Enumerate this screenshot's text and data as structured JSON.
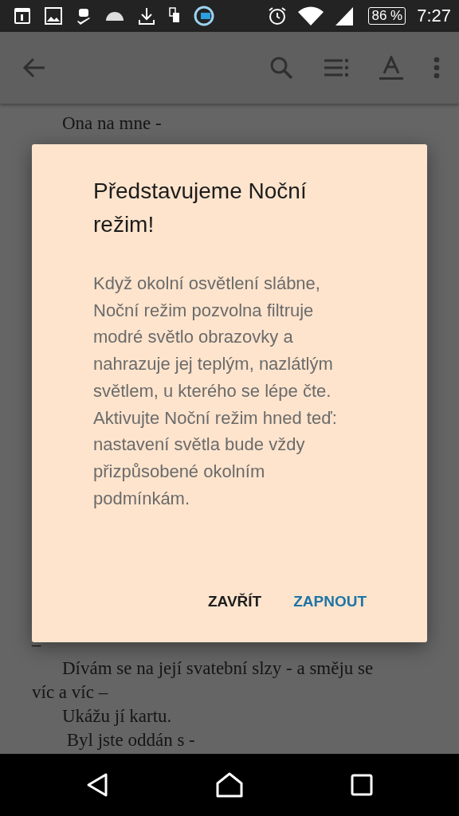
{
  "status_bar": {
    "battery": "86 %",
    "time": "7:27"
  },
  "book_text": {
    "top": [
      {
        "text": "Ona na mne -",
        "kind": "paragraph"
      }
    ],
    "bottom": [
      {
        "text": "–",
        "kind": "continuation"
      },
      {
        "text": "Dívám se na její svatební slzy - a směju se",
        "kind": "paragraph"
      },
      {
        "text": "víc a víc –",
        "kind": "continuation"
      },
      {
        "text": "Ukážu jí kartu.",
        "kind": "paragraph"
      },
      {
        "text": " Byl jste oddán s -",
        "kind": "paragraph"
      }
    ]
  },
  "dialog": {
    "title": "Představujeme Noční režim!",
    "body": "Když okolní osvětlení slábne, Noční režim pozvolna filtruje modré světlo obrazovky a nahrazuje jej teplým, nazlátlým světlem, u kterého se lépe čte. Aktivujte Noční režim hned teď: nastavení světla bude vždy přizpůsobené okolním podmínkám.",
    "buttons": [
      {
        "label": "ZAVŘÍT",
        "kind": "neutral"
      },
      {
        "label": "ZAPNOUT",
        "kind": "primary"
      }
    ]
  }
}
